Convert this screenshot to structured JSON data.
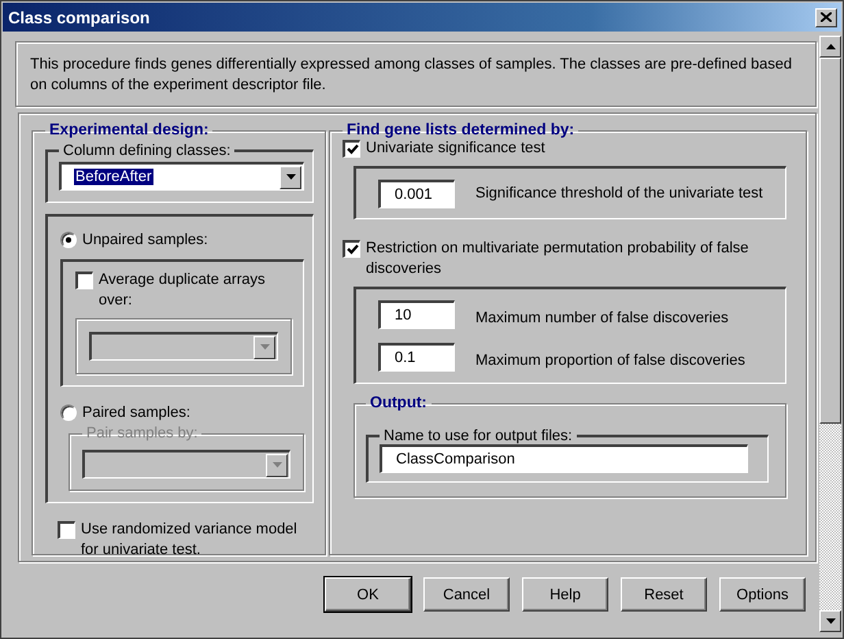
{
  "window": {
    "title": "Class comparison"
  },
  "description": "This procedure finds genes differentially expressed among classes of samples. The classes are pre-defined based on columns of the experiment descriptor file.",
  "experimental_design": {
    "title": "Experimental design:",
    "column_select": {
      "label": "Column defining classes:",
      "value": "BeforeAfter",
      "disabled": false
    },
    "unpaired": {
      "label": "Unpaired samples:",
      "selected": true
    },
    "average_duplicates": {
      "label": "Average duplicate arrays over:",
      "checked": false,
      "dropdown_disabled": true
    },
    "paired": {
      "label": "Paired samples:",
      "selected": false
    },
    "pair_by": {
      "label": "Pair samples by:",
      "disabled": true
    },
    "randomized_variance": {
      "label": "Use randomized variance model for univariate test.",
      "checked": false
    }
  },
  "find_gene_lists": {
    "title": "Find gene lists determined by:",
    "univariate": {
      "label": "Univariate significance test",
      "checked": true
    },
    "threshold": {
      "value": "0.001",
      "label": "Significance threshold of the univariate test"
    },
    "restriction": {
      "label": "Restriction on multivariate permutation probability of false discoveries",
      "checked": true
    },
    "restriction_fields": [
      {
        "value": "10",
        "label": "Maximum number of false discoveries"
      },
      {
        "value": "0.1",
        "label": "Maximum proportion of false discoveries"
      }
    ],
    "output": {
      "title": "Output:",
      "label": "Name to use for output files:",
      "value": "ClassComparison"
    }
  },
  "buttons": [
    {
      "label": "OK",
      "default": true
    },
    {
      "label": "Cancel",
      "default": false
    },
    {
      "label": "Help",
      "default": false
    },
    {
      "label": "Reset",
      "default": false
    },
    {
      "label": "Options",
      "default": false
    }
  ]
}
